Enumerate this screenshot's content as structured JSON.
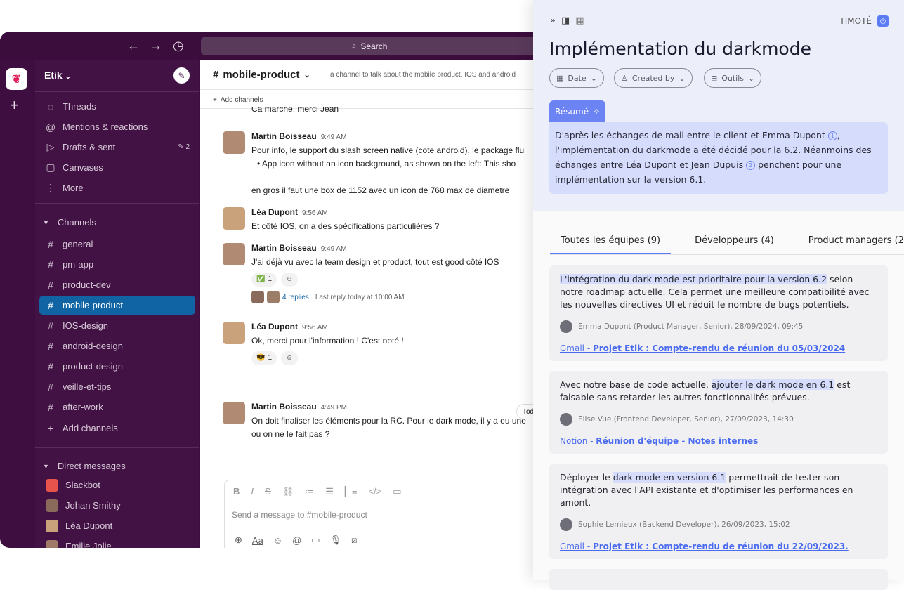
{
  "search": {
    "placeholder": "Search"
  },
  "workspace": {
    "name": "Etik"
  },
  "sidebar": {
    "nav": [
      {
        "icon": "threads-icon",
        "label": "Threads"
      },
      {
        "icon": "at-icon",
        "label": "Mentions & reactions"
      },
      {
        "icon": "send-icon",
        "label": "Drafts & sent",
        "count": "2"
      },
      {
        "icon": "canvas-icon",
        "label": "Canvases"
      },
      {
        "icon": "more-icon",
        "label": "More"
      }
    ],
    "channels_title": "Channels",
    "channels": [
      "general",
      "pm-app",
      "product-dev",
      "mobile-product",
      "IOS-design",
      "android-design",
      "product-design",
      "veille-et-tips",
      "after-work"
    ],
    "active_channel": "mobile-product",
    "add_channels": "Add channels",
    "dm_title": "Direct messages",
    "dms": [
      "Slackbot",
      "Johan Smithy",
      "Léa Dupont",
      "Emilie Jolie"
    ]
  },
  "channel": {
    "name": "mobile-product",
    "description": "a channel to talk about the mobile product, IOS and android",
    "add_channels": "Add channels"
  },
  "messages": [
    {
      "text": "Ca marche, merci Jean"
    },
    {
      "author": "Martin Boisseau",
      "time": "9:49 AM",
      "text": "Pour info, le support du slash screen native (cote android), le package flu",
      "bullet": "App icon without an icon background, as shown on the left: This sho",
      "text2": "en gros il faut une box de 1152 avec un icon de 768 max de diametre"
    },
    {
      "author": "Léa Dupont",
      "time": "9:56 AM",
      "text": "Et côté IOS, on a des spécifications particulières ?"
    },
    {
      "author": "Martin Boisseau",
      "time": "9:49 AM",
      "text": "J'ai déjà vu avec la team design et product, tout est good côté IOS",
      "reaction": "✅",
      "reaction_count": "1",
      "replies": "4 replies",
      "last_reply": "Last reply today at 10:00 AM"
    },
    {
      "author": "Léa Dupont",
      "time": "9:56 AM",
      "text": "Ok, merci pour l'information ! C'est noté !",
      "reaction": "😎",
      "reaction_count": "1"
    },
    {
      "author": "Martin Boisseau",
      "time": "4:49 PM",
      "text": "On doit finaliser les éléments pour la RC. Pour le dark mode, il y a eu une",
      "text2": "ou on ne le fait pas ?"
    }
  ],
  "today_label": "Tod",
  "composer": {
    "placeholder": "Send a message to #mobile-product"
  },
  "panel": {
    "brand": "TIMOTÉ",
    "title": "Implémentation du darkmode",
    "filters": [
      "Date",
      "Created by",
      "Outils"
    ],
    "summary_label": "Résumé",
    "summary": [
      "D'après les échanges de mail entre le client et Emma Dupont",
      "l'implémentation du darkmode a été décidé pour la 6.2. Néanmoins des",
      "échanges entre Léa Dupont et Jean Dupuis",
      "penchent pour une",
      "implémentation sur la version 6.1."
    ],
    "ref1": "1",
    "ref2": "2",
    "tabs": [
      "Toutes les équipes (9)",
      "Développeurs (4)",
      "Product managers (2)"
    ],
    "cards": [
      {
        "hl": "L'intégration du dark mode est prioritaire pour la version 6.2",
        "pre": "",
        "post": " selon notre roadmap actuelle. Cela permet une meilleure compatibilité avec les nouvelles directives UI et réduit le nombre de bugs potentiels.",
        "meta": "Emma Dupont (Product Manager, Senior), 28/09/2024, 09:45",
        "source": "Gmail - ",
        "link": "Projet Etik : Compte-rendu de réunion du 05/03/2024"
      },
      {
        "pre": "Avec notre base de code actuelle, ",
        "hl": "ajouter le dark mode en 6.1",
        "post": " est faisable sans retarder les autres fonctionnalités prévues.",
        "meta": "Elise Vue (Frontend Developer, Senior), 27/09/2023, 14:30",
        "source": "Notion - ",
        "link": "Réunion d'équipe - Notes internes"
      },
      {
        "pre": "Déployer le ",
        "hl": "dark mode en version 6.1",
        "post": " permettrait de tester son intégration avec l'API existante et d'optimiser les performances en amont.",
        "meta": "Sophie Lemieux (Backend Developer), 26/09/2023, 15:02",
        "source": "Gmail - ",
        "link": "Projet Etik : Compte-rendu de réunion du 22/09/2023."
      }
    ]
  }
}
